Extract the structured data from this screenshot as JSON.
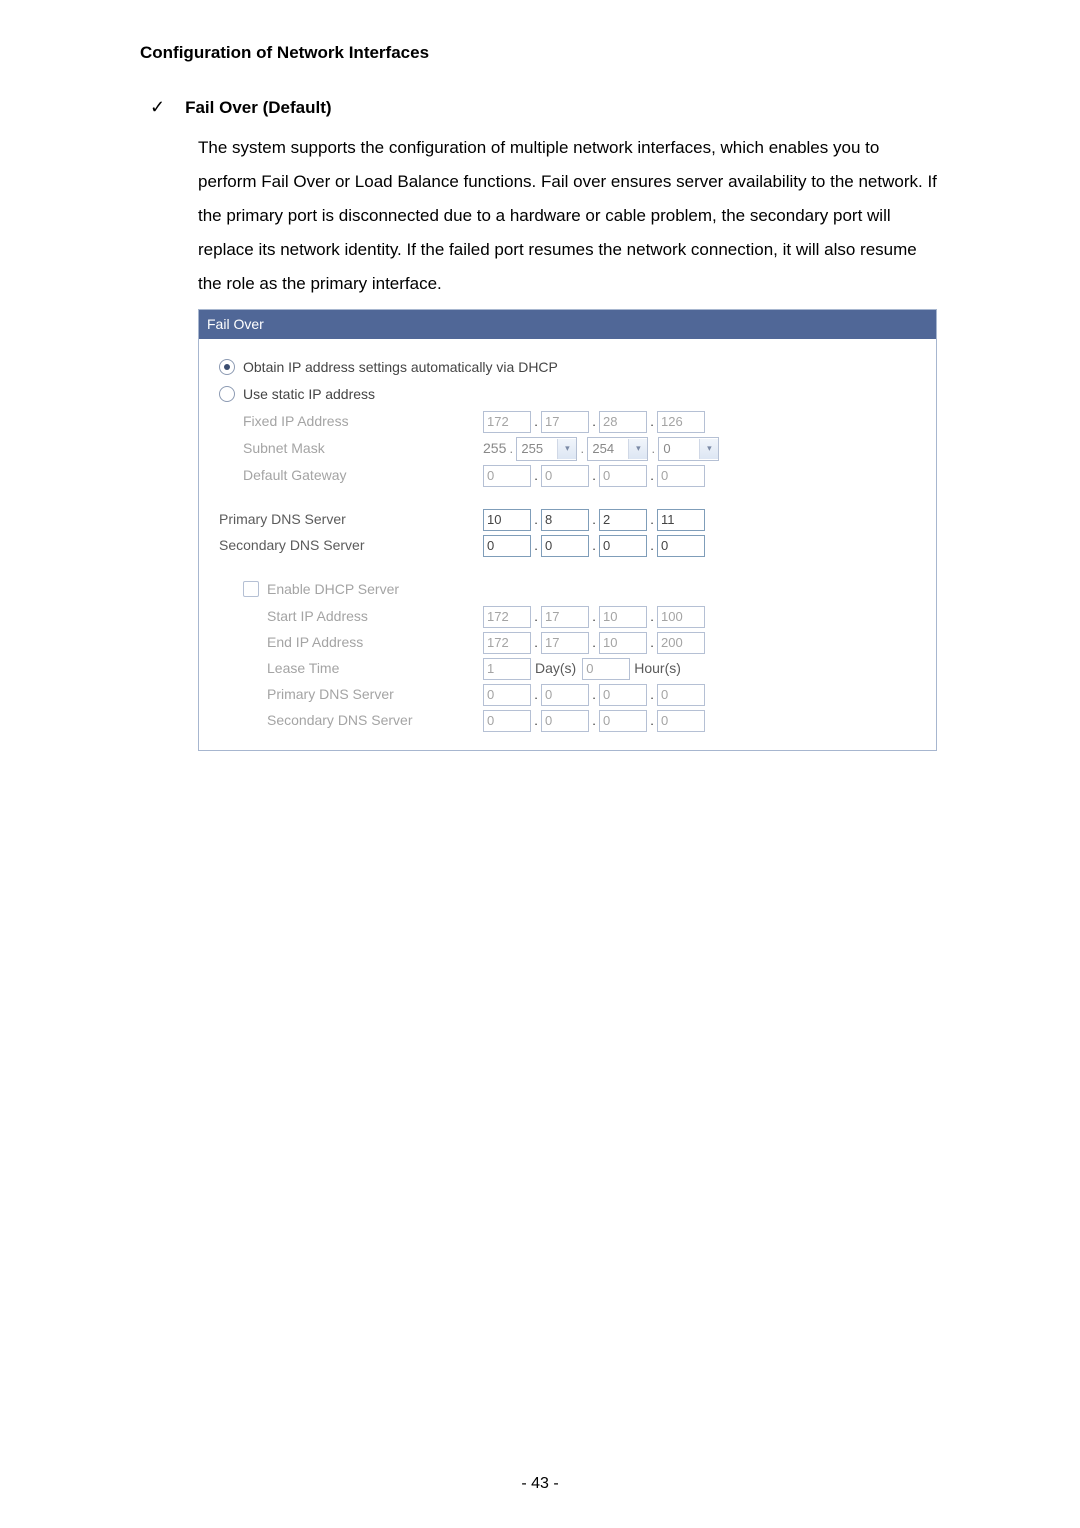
{
  "heading": "Configuration of Network Interfaces",
  "sub_heading": "Fail Over (Default)",
  "body_text": "The system supports the configuration of multiple network interfaces, which enables you to perform Fail Over or Load Balance functions.  Fail over ensures server availability to the network.  If the primary port is disconnected due to a hardware or cable problem, the secondary port will replace its network identity.  If the failed port resumes the network connection, it will also resume the role as the primary interface.",
  "panel_title": "Fail Over",
  "radios": {
    "dhcp": "Obtain IP address settings automatically via DHCP",
    "static": "Use static IP address"
  },
  "fixed_ip_label": "Fixed IP Address",
  "fixed_ip": [
    "172",
    "17",
    "28",
    "126"
  ],
  "subnet_label": "Subnet Mask",
  "subnet_prefix": "255",
  "subnet_sel1": "255",
  "subnet_sel2": "254",
  "subnet_sel3": "0",
  "gateway_label": "Default Gateway",
  "gateway": [
    "0",
    "0",
    "0",
    "0"
  ],
  "primary_dns_label": "Primary DNS Server",
  "primary_dns": [
    "10",
    "8",
    "2",
    "11"
  ],
  "secondary_dns_label": "Secondary DNS Server",
  "secondary_dns": [
    "0",
    "0",
    "0",
    "0"
  ],
  "enable_dhcp_label": "Enable DHCP Server",
  "start_ip_label": "Start IP Address",
  "start_ip": [
    "172",
    "17",
    "10",
    "100"
  ],
  "end_ip_label": "End IP Address",
  "end_ip": [
    "172",
    "17",
    "10",
    "200"
  ],
  "lease_label": "Lease Time",
  "lease_days": "1",
  "lease_days_word": "Day(s)",
  "lease_hours": "0",
  "lease_hours_word": "Hour(s)",
  "dhcp_primary_dns_label": "Primary DNS Server",
  "dhcp_primary_dns": [
    "0",
    "0",
    "0",
    "0"
  ],
  "dhcp_secondary_dns_label": "Secondary DNS Server",
  "dhcp_secondary_dns": [
    "0",
    "0",
    "0",
    "0"
  ],
  "page_number": "- 43 -"
}
